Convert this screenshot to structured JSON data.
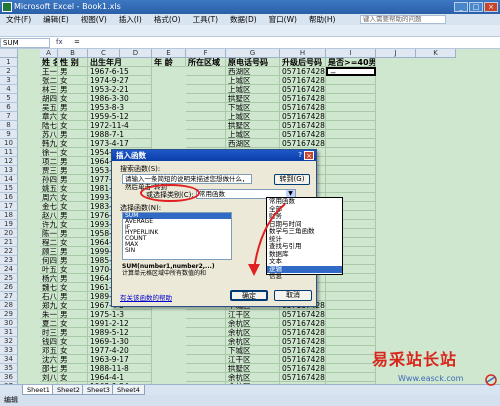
{
  "app": {
    "title": "Microsoft Excel - Book1.xls",
    "window_buttons": [
      "_",
      "□",
      "×"
    ]
  },
  "menu": {
    "items": [
      "文件(F)",
      "编辑(E)",
      "视图(V)",
      "插入(I)",
      "格式(O)",
      "工具(T)",
      "数据(D)",
      "窗口(W)",
      "帮助(H)"
    ],
    "search_placeholder": "键入需要帮助的问题"
  },
  "formula_bar": {
    "name_box": "SUM",
    "fx_label": "fx",
    "content": "="
  },
  "columns": [
    "A",
    "B",
    "C",
    "D",
    "E",
    "F",
    "G",
    "H",
    "I",
    "J",
    "K"
  ],
  "headers": [
    "姓 名",
    "性 别",
    "出生年月",
    "年 龄",
    "所在区域",
    "原电话号码",
    "升级后号码",
    "是否>=40男性"
  ],
  "rows": [
    [
      "王一",
      "男",
      "1967-6-15",
      "",
      "西湖区",
      "05716742801",
      "="
    ],
    [
      "张二",
      "女",
      "1974-9-27",
      "",
      "上城区",
      "05716742802",
      ""
    ],
    [
      "林三",
      "男",
      "1953-2-21",
      "",
      "上城区",
      "05716742803",
      ""
    ],
    [
      "胡四",
      "女",
      "1986-3-30",
      "",
      "拱墅区",
      "05716742804",
      ""
    ],
    [
      "吴五",
      "男",
      "1953-8-3",
      "",
      "下城区",
      "05716742805",
      ""
    ],
    [
      "章六",
      "女",
      "1959-5-12",
      "",
      "上城区",
      "05716742806",
      ""
    ],
    [
      "陆七",
      "女",
      "1972-11-4",
      "",
      "拱墅区",
      "05716742807",
      ""
    ],
    [
      "苏八",
      "男",
      "1988-7-1",
      "",
      "上城区",
      "05716742808",
      ""
    ],
    [
      "韩九",
      "女",
      "1973-4-17",
      "",
      "西湖区",
      "05716742809",
      ""
    ],
    [
      "徐一",
      "女",
      "1954-",
      "",
      "",
      "",
      ""
    ],
    [
      "项二",
      "男",
      "1964-",
      "",
      "",
      "",
      ""
    ],
    [
      "贾三",
      "男",
      "1953-",
      "",
      "",
      "",
      ""
    ],
    [
      "孙四",
      "男",
      "1977-",
      "",
      "",
      "",
      ""
    ],
    [
      "姚五",
      "女",
      "1981-",
      "",
      "",
      "",
      ""
    ],
    [
      "周六",
      "女",
      "1993-",
      "",
      "",
      "",
      ""
    ],
    [
      "金七",
      "女",
      "1983-",
      "",
      "",
      "",
      ""
    ],
    [
      "赵八",
      "男",
      "1976-",
      "",
      "",
      "",
      ""
    ],
    [
      "许九",
      "女",
      "1993-",
      "",
      "",
      "",
      ""
    ],
    [
      "陈一",
      "男",
      "1958-",
      "",
      "",
      "",
      ""
    ],
    [
      "程二",
      "女",
      "1964-",
      "",
      "",
      "",
      ""
    ],
    [
      "顾三",
      "男",
      "1999-",
      "",
      "",
      "",
      ""
    ],
    [
      "何四",
      "男",
      "1985-",
      "",
      "",
      "",
      ""
    ],
    [
      "叶五",
      "女",
      "1970-",
      "",
      "",
      "",
      ""
    ],
    [
      "杨六",
      "男",
      "1964-1",
      "",
      "",
      "",
      ""
    ],
    [
      "魏七",
      "女",
      "1961-1",
      "",
      "",
      "",
      ""
    ],
    [
      "石八",
      "男",
      "1989-",
      "",
      "",
      "",
      ""
    ],
    [
      "郑九",
      "女",
      "1967-4-5",
      "",
      "下城区",
      "05716742826",
      ""
    ],
    [
      "朱一",
      "男",
      "1975-1-3",
      "",
      "江干区",
      "05716742827",
      ""
    ],
    [
      "夏二",
      "女",
      "1991-2-12",
      "",
      "余杭区",
      "05716742828",
      ""
    ],
    [
      "时三",
      "男",
      "1989-5-12",
      "",
      "余杭区",
      "05716742829",
      ""
    ],
    [
      "钱四",
      "女",
      "1969-1-30",
      "",
      "余杭区",
      "05716742830",
      ""
    ],
    [
      "邓五",
      "女",
      "1977-4-20",
      "",
      "下城区",
      "05716742831",
      ""
    ],
    [
      "沈六",
      "男",
      "1963-9-17",
      "",
      "江干区",
      "05716742832",
      ""
    ],
    [
      "邵七",
      "男",
      "1988-11-8",
      "",
      "拱墅区",
      "05716742833",
      ""
    ],
    [
      "刘八",
      "女",
      "1964-4-1",
      "",
      "余杭区",
      "05716742834",
      ""
    ],
    [
      "",
      "",
      "1963-9-24",
      "",
      "余杭区",
      "",
      ""
    ]
  ],
  "sheet_tabs": [
    "Sheet1",
    "Sheet2",
    "Sheet3",
    "Sheet4"
  ],
  "status": "编辑",
  "dialog": {
    "title": "插入函数",
    "search_label": "搜索函数(S):",
    "search_value": "请输入一条简短的说明来描述您想做什么，然后单击\"转到\"",
    "go_button": "转到(G)",
    "category_label": "或选择类别(C):",
    "category_value": "常用函数",
    "function_label": "选择函数(N):",
    "functions": [
      "SUM",
      "AVERAGE",
      "IF",
      "HYPERLINK",
      "COUNT",
      "MAX",
      "SIN"
    ],
    "selected_function": "SUM",
    "syntax": "SUM(number1,number2,...)",
    "description": "计算单元格区域中所有数值的和",
    "help_link": "有关该函数的帮助",
    "ok_button": "确定",
    "cancel_button": "取消",
    "help_button": "?",
    "close_button": "×"
  },
  "category_dropdown": [
    "常用函数",
    "全部",
    "财务",
    "日期与时间",
    "数学与三角函数",
    "统计",
    "查找与引用",
    "数据库",
    "文本",
    "逻辑",
    "信息"
  ],
  "category_selected_index": 9,
  "watermark": {
    "text": "易采站长站",
    "url": "Www.easck.com"
  },
  "colors": {
    "accent": "#316ac5",
    "grid": "#cfe6cf",
    "annotation": "#e02020"
  }
}
